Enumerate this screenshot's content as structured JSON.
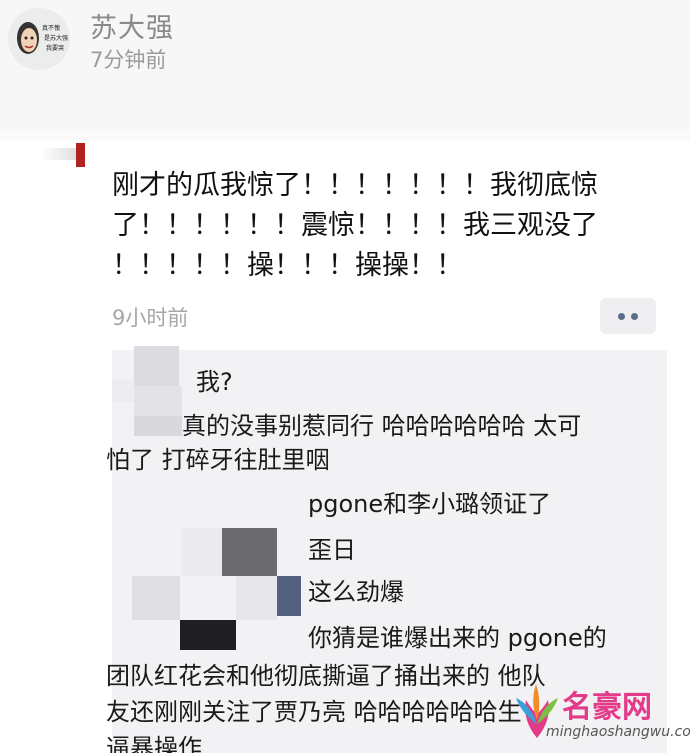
{
  "author": {
    "name": "苏大强",
    "time": "7分钟前",
    "avatar_text": [
      "真不愧",
      "是苏大强",
      "我要哭"
    ]
  },
  "post": {
    "lines": [
      "刚才的瓜我惊了！！！！！！！我彻底惊",
      "了！！！！！！震惊！！！！我三观没了",
      "！！！！！操！！！操操！！"
    ],
    "time": "9小时前"
  },
  "comments": {
    "lines": [
      "我?",
      "真的没事别惹同行 哈哈哈哈哈哈 太可",
      "怕了 打碎牙往肚里咽",
      "pgone和李小璐领证了",
      "歪日",
      "这么劲爆",
      "你猜是谁爆出来的 pgone的",
      "团队红花会和他彻底撕逼了捅出来的 他队",
      "友还刚刚关注了贾乃亮 哈哈哈哈哈哈生",
      "逼暴操作"
    ]
  },
  "watermark": {
    "name": "名豪网",
    "url": "minghaoshangwu.com"
  },
  "icons": {
    "more": "more-dots-icon",
    "avatar": "avatar-cartoon-icon",
    "logo": "minghao-logo-icon"
  },
  "colors": {
    "accent": "#b22222",
    "link": "#5b6b8a",
    "watermark": "#e33b8a"
  }
}
